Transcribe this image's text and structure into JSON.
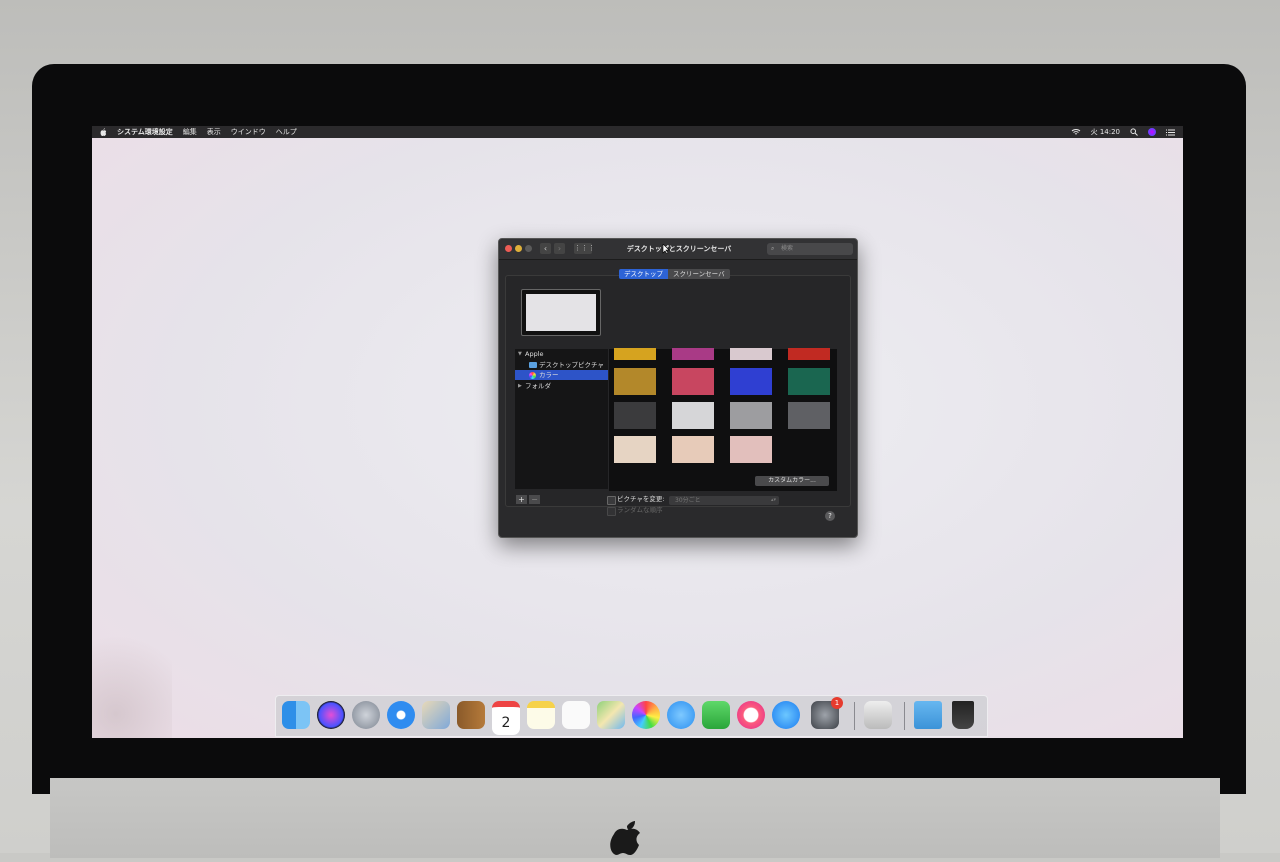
{
  "menubar": {
    "app_name": "システム環境設定",
    "menus": [
      "編集",
      "表示",
      "ウインドウ",
      "ヘルプ"
    ],
    "clock": "火 14:20"
  },
  "window": {
    "title": "デスクトップとスクリーンセーバ",
    "search_placeholder": "検索",
    "tabs": [
      {
        "label": "デスクトップ",
        "selected": true
      },
      {
        "label": "スクリーンセーバ",
        "selected": false
      }
    ],
    "sidebar": {
      "group": "Apple",
      "items": [
        "デスクトップピクチャ",
        "カラー"
      ],
      "selected": "カラー",
      "folders_label": "フォルダ"
    },
    "swatch_colors": [
      [
        "#d6a31f",
        "#a93a86",
        "#d9c9cf",
        "#c12a22"
      ],
      [
        "#b3882a",
        "#c84660",
        "#2f3fd2",
        "#1a6650"
      ],
      [
        "#3b3b3d",
        "#d6d6d8",
        "#9d9da0",
        "#5f6064"
      ],
      [
        "#e6d4c3",
        "#e7cbb9",
        "#e2bfbc"
      ]
    ],
    "custom_color_button": "カスタムカラー...",
    "add_button": "+",
    "remove_button": "−",
    "change_picture_label": "ピクチャを変更:",
    "interval_value": "30分ごと",
    "random_order_label": "ランダムな順序",
    "help_label": "?"
  },
  "dock": {
    "calendar_day": "2",
    "badge_count": "1"
  }
}
